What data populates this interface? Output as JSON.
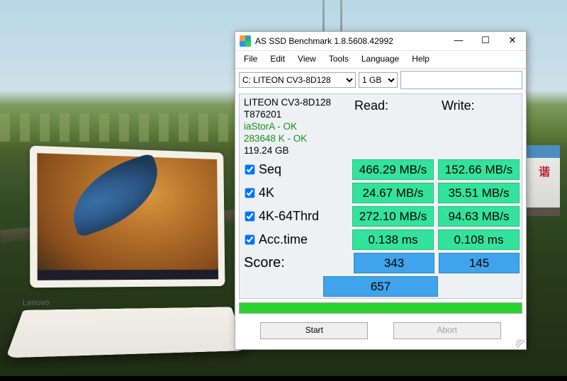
{
  "window": {
    "title": "AS SSD Benchmark 1.8.5608.42992",
    "minimize": "—",
    "maximize": "☐",
    "close": "✕"
  },
  "menu": {
    "file": "File",
    "edit": "Edit",
    "view": "View",
    "tools": "Tools",
    "language": "Language",
    "help": "Help"
  },
  "toolbar": {
    "drive": "C: LITEON CV3-8D128",
    "size": "1 GB"
  },
  "info": {
    "model": "LITEON CV3-8D128",
    "firmware": "T876201",
    "driver": "iaStorA - OK",
    "alignment": "283648 K - OK",
    "capacity": "119.24 GB"
  },
  "headers": {
    "read": "Read:",
    "write": "Write:"
  },
  "rows": {
    "seq": {
      "label": "Seq",
      "read": "466.29 MB/s",
      "write": "152.66 MB/s"
    },
    "k4": {
      "label": "4K",
      "read": "24.67 MB/s",
      "write": "35.51 MB/s"
    },
    "k4t": {
      "label": "4K-64Thrd",
      "read": "272.10 MB/s",
      "write": "94.63 MB/s"
    },
    "acc": {
      "label": "Acc.time",
      "read": "0.138 ms",
      "write": "0.108 ms"
    }
  },
  "score": {
    "label": "Score:",
    "read": "343",
    "write": "145",
    "total": "657"
  },
  "buttons": {
    "start": "Start",
    "abort": "Abort"
  },
  "laptop": {
    "brand": "Lenovo"
  }
}
